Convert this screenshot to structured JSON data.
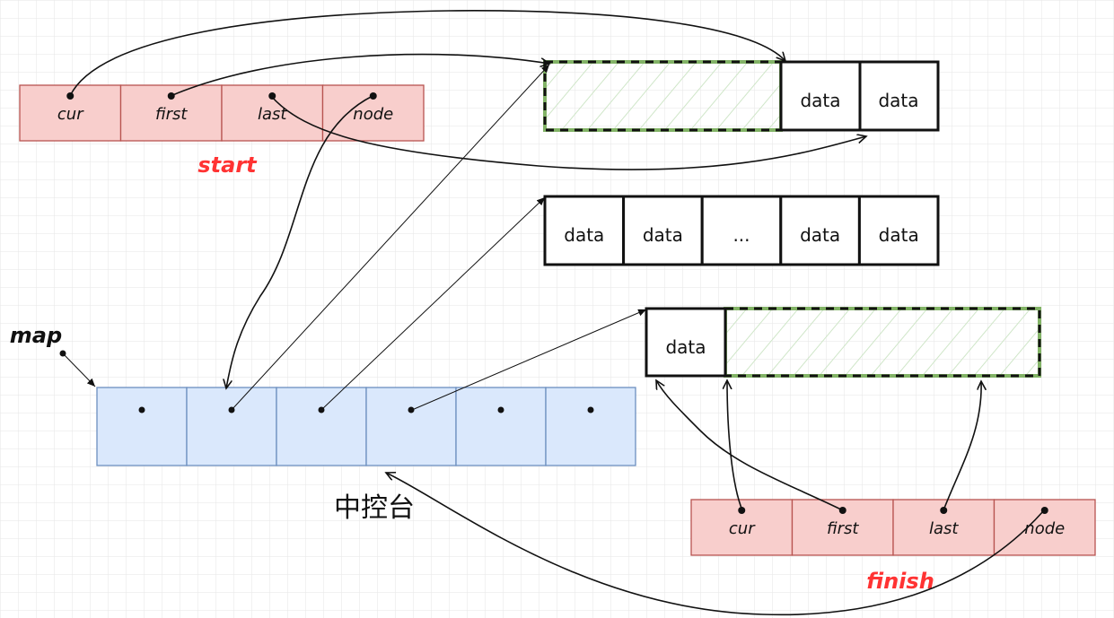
{
  "colors": {
    "struct_fill": "#f8cecc",
    "struct_stroke": "#b85450",
    "map_fill": "#dae8fc",
    "map_stroke": "#6c8ebf",
    "hatch": "#82b366",
    "title_red": "#ff3333"
  },
  "start": {
    "title": "start",
    "fields": [
      "cur",
      "first",
      "last",
      "node"
    ]
  },
  "finish": {
    "title": "finish",
    "fields": [
      "cur",
      "first",
      "last",
      "node"
    ]
  },
  "map": {
    "label": "map",
    "caption": "中控台",
    "cells": 6
  },
  "buffers": [
    {
      "cells": [
        "data",
        "data"
      ]
    },
    {
      "cells": [
        "data",
        "data",
        "...",
        "data",
        "data"
      ]
    },
    {
      "cells": [
        "data"
      ]
    }
  ]
}
